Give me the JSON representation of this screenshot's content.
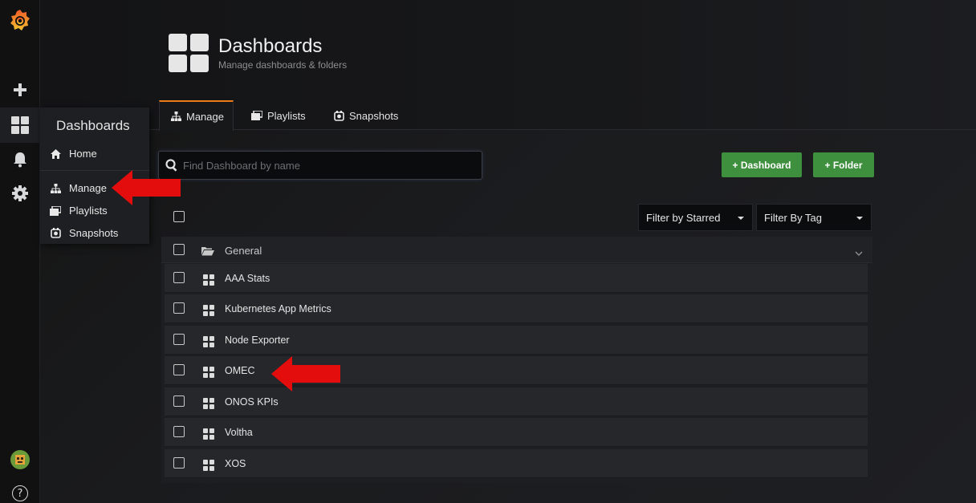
{
  "sidebar": {
    "icons": [
      "grafana-logo-icon",
      "plus-icon",
      "dashboards-icon",
      "bell-icon",
      "gear-icon",
      "avatar",
      "help-icon"
    ],
    "help_label": "?"
  },
  "submenu": {
    "title": "Dashboards",
    "items": [
      {
        "label": "Home",
        "icon": "home-icon"
      },
      {
        "label": "Manage",
        "icon": "sitemap-icon"
      },
      {
        "label": "Playlists",
        "icon": "playlist-icon"
      },
      {
        "label": "Snapshots",
        "icon": "camera-icon"
      }
    ]
  },
  "header": {
    "title": "Dashboards",
    "subtitle": "Manage dashboards & folders"
  },
  "tabs": [
    {
      "label": "Manage",
      "active": true
    },
    {
      "label": "Playlists",
      "active": false
    },
    {
      "label": "Snapshots",
      "active": false
    }
  ],
  "search": {
    "placeholder": "Find Dashboard by name",
    "value": ""
  },
  "actions": {
    "new_dashboard": "+ Dashboard",
    "new_folder": "+ Folder"
  },
  "filters": {
    "starred": "Filter by Starred",
    "tag": "Filter By Tag"
  },
  "folder": {
    "name": "General"
  },
  "dashboards": [
    "AAA Stats",
    "Kubernetes App Metrics",
    "Node Exporter",
    "OMEC",
    "ONOS KPIs",
    "Voltha",
    "XOS"
  ],
  "colors": {
    "accent": "#eb7b18",
    "button_green": "#3e8f3e",
    "annotation_arrow": "#e30d0d",
    "background": "#161719"
  }
}
